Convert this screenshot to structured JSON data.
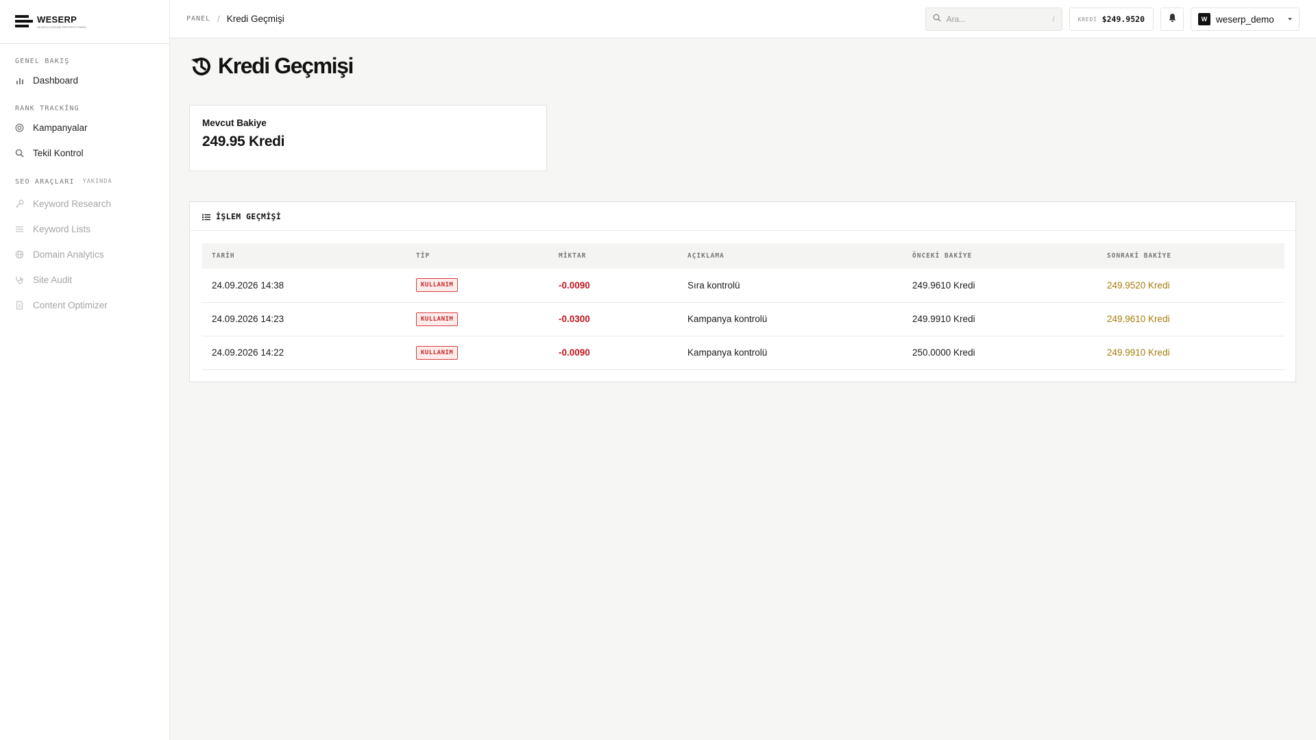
{
  "brand": {
    "name": "WESERP",
    "tagline": "SEARCH ENGINE REPORTS PANEL"
  },
  "sidebar": {
    "sections": [
      {
        "heading": "GENEL BAKIŞ",
        "badge": "",
        "items": [
          {
            "label": "Dashboard",
            "icon": "bar-chart-icon",
            "disabled": false
          }
        ]
      },
      {
        "heading": "RANK TRACKİNG",
        "badge": "",
        "items": [
          {
            "label": "Kampanyalar",
            "icon": "target-icon",
            "disabled": false
          },
          {
            "label": "Tekil Kontrol",
            "icon": "search-icon",
            "disabled": false
          }
        ]
      },
      {
        "heading": "SEO ARAÇLARI",
        "badge": "YAKINDA",
        "items": [
          {
            "label": "Keyword Research",
            "icon": "key-icon",
            "disabled": true
          },
          {
            "label": "Keyword Lists",
            "icon": "list-icon",
            "disabled": true
          },
          {
            "label": "Domain Analytics",
            "icon": "globe-icon",
            "disabled": true
          },
          {
            "label": "Site Audit",
            "icon": "stethoscope-icon",
            "disabled": true
          },
          {
            "label": "Content Optimizer",
            "icon": "document-icon",
            "disabled": true
          }
        ]
      }
    ]
  },
  "topbar": {
    "breadcrumb_root": "PANEL",
    "breadcrumb_sep": "/",
    "breadcrumb_current": "Kredi Geçmişi",
    "search_placeholder": "Ara...",
    "search_hint": "/",
    "credit_label": "KREDİ",
    "credit_value": "$249.9520",
    "user_initial": "W",
    "username": "weserp_demo"
  },
  "page": {
    "title": "Kredi Geçmişi",
    "balance_label": "Mevcut Bakiye",
    "balance_value": "249.95 Kredi",
    "tx_title": "İŞLEM GEÇMİŞİ",
    "columns": [
      "TARİH",
      "TİP",
      "MİKTAR",
      "AÇIKLAMA",
      "ÖNCEKİ BAKİYE",
      "SONRAKİ BAKİYE"
    ],
    "rows": [
      {
        "date": "24.09.2026 14:38",
        "type": "KULLANIM",
        "amount": "-0.0090",
        "description": "Sıra kontrolü",
        "before": "249.9610 Kredi",
        "after": "249.9520 Kredi"
      },
      {
        "date": "24.09.2026 14:23",
        "type": "KULLANIM",
        "amount": "-0.0300",
        "description": "Kampanya kontrolü",
        "before": "249.9910 Kredi",
        "after": "249.9610 Kredi"
      },
      {
        "date": "24.09.2026 14:22",
        "type": "KULLANIM",
        "amount": "-0.0090",
        "description": "Kampanya kontrolü",
        "before": "250.0000 Kredi",
        "after": "249.9910 Kredi"
      }
    ]
  },
  "colors": {
    "accent_negative": "#c0161e",
    "accent_after": "#a57a07",
    "badge_red": "#d63b3b"
  }
}
